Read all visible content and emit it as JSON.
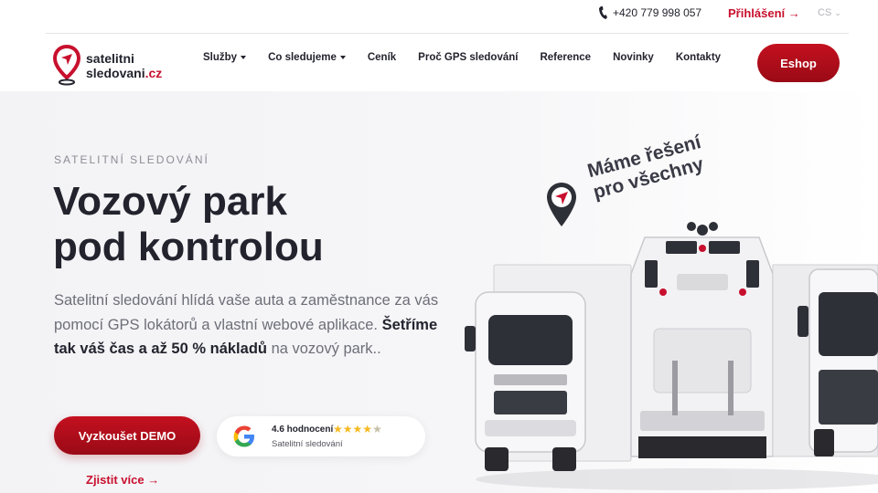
{
  "topbar": {
    "phone": "+420 779 998 057",
    "login": "Přihlášení →",
    "lang": "CS"
  },
  "logo": {
    "line1": "satelitni",
    "line2": "sledovani",
    "tld": ".cz"
  },
  "nav": {
    "items": [
      {
        "label": "Služby",
        "dropdown": true
      },
      {
        "label": "Co sledujeme",
        "dropdown": true
      },
      {
        "label": "Ceník"
      },
      {
        "label": "Proč GPS sledování"
      },
      {
        "label": "Reference"
      },
      {
        "label": "Novinky"
      },
      {
        "label": "Kontakty"
      }
    ],
    "eshop": "Eshop"
  },
  "hero": {
    "eyebrow": "SATELITNÍ SLEDOVÁNÍ",
    "title_line1": "Vozový park",
    "title_line2": "pod kontrolou",
    "lead_part1": "Satelitní sledování hlídá vaše auta a zaměstnance za vás pomocí GPS lokátorů a vlastní webové aplikace. ",
    "lead_bold": "Šetříme tak váš čas a až 50 % nákladů",
    "lead_part2": " na vozový park..",
    "demo_button": "Vyzkoušet DEMO",
    "more_link": "Zjistit více →",
    "badge_line1": "Máme řešení",
    "badge_line2": "pro všechny"
  },
  "rating": {
    "score_label": "4.6 hodnocení",
    "stars": 4.6,
    "source": "Satelitní sledování"
  },
  "colors": {
    "accent": "#c8102e",
    "dark": "#23232e"
  },
  "icons": [
    "phone-icon",
    "logo-pin-icon",
    "google-icon",
    "star-icon",
    "badge-pin-icon"
  ]
}
